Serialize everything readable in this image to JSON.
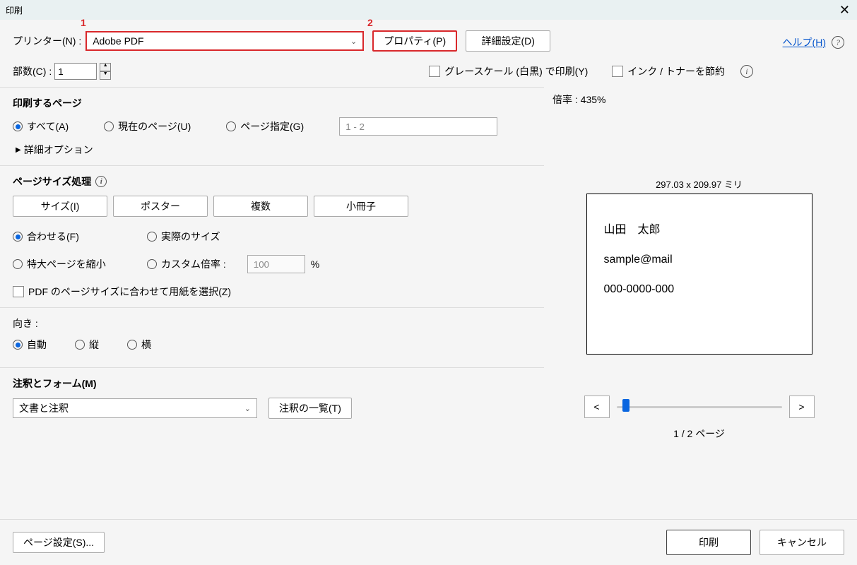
{
  "window": {
    "title": "印刷"
  },
  "annotations": {
    "num1": "1",
    "num2": "2"
  },
  "top": {
    "printer_label": "プリンター(N) :",
    "printer_value": "Adobe PDF",
    "properties_btn": "プロパティ(P)",
    "advanced_btn": "詳細設定(D)",
    "help_link": "ヘルプ(H)",
    "copies_label": "部数(C) :",
    "copies_value": "1",
    "grayscale_label": "グレースケール (白黒) で印刷(Y)",
    "save_ink_label": "インク / トナーを節約"
  },
  "pages": {
    "title": "印刷するページ",
    "all": "すべて(A)",
    "current": "現在のページ(U)",
    "range": "ページ指定(G)",
    "range_value": "1 - 2",
    "more": "詳細オプション"
  },
  "size": {
    "title": "ページサイズ処理",
    "size_btn": "サイズ(I)",
    "poster_btn": "ポスター",
    "multi_btn": "複数",
    "booklet_btn": "小冊子",
    "fit": "合わせる(F)",
    "actual": "実際のサイズ",
    "shrink": "特大ページを縮小",
    "custom": "カスタム倍率 :",
    "custom_value": "100",
    "percent": "%",
    "choose_paper": "PDF のページサイズに合わせて用紙を選択(Z)"
  },
  "orient": {
    "title": "向き :",
    "auto": "自動",
    "portrait": "縦",
    "landscape": "横"
  },
  "annot": {
    "title": "注釈とフォーム(M)",
    "value": "文書と注釈",
    "list_btn": "注釈の一覧(T)"
  },
  "preview": {
    "zoom": "倍率 : 435%",
    "dims": "297.03 x 209.97 ミリ",
    "line1": "山田　太郎",
    "line2": "sample@mail",
    "line3": "000-0000-000",
    "prev": "<",
    "next": ">",
    "page_ind": "1 / 2 ページ"
  },
  "footer": {
    "page_setup": "ページ設定(S)...",
    "print": "印刷",
    "cancel": "キャンセル"
  }
}
